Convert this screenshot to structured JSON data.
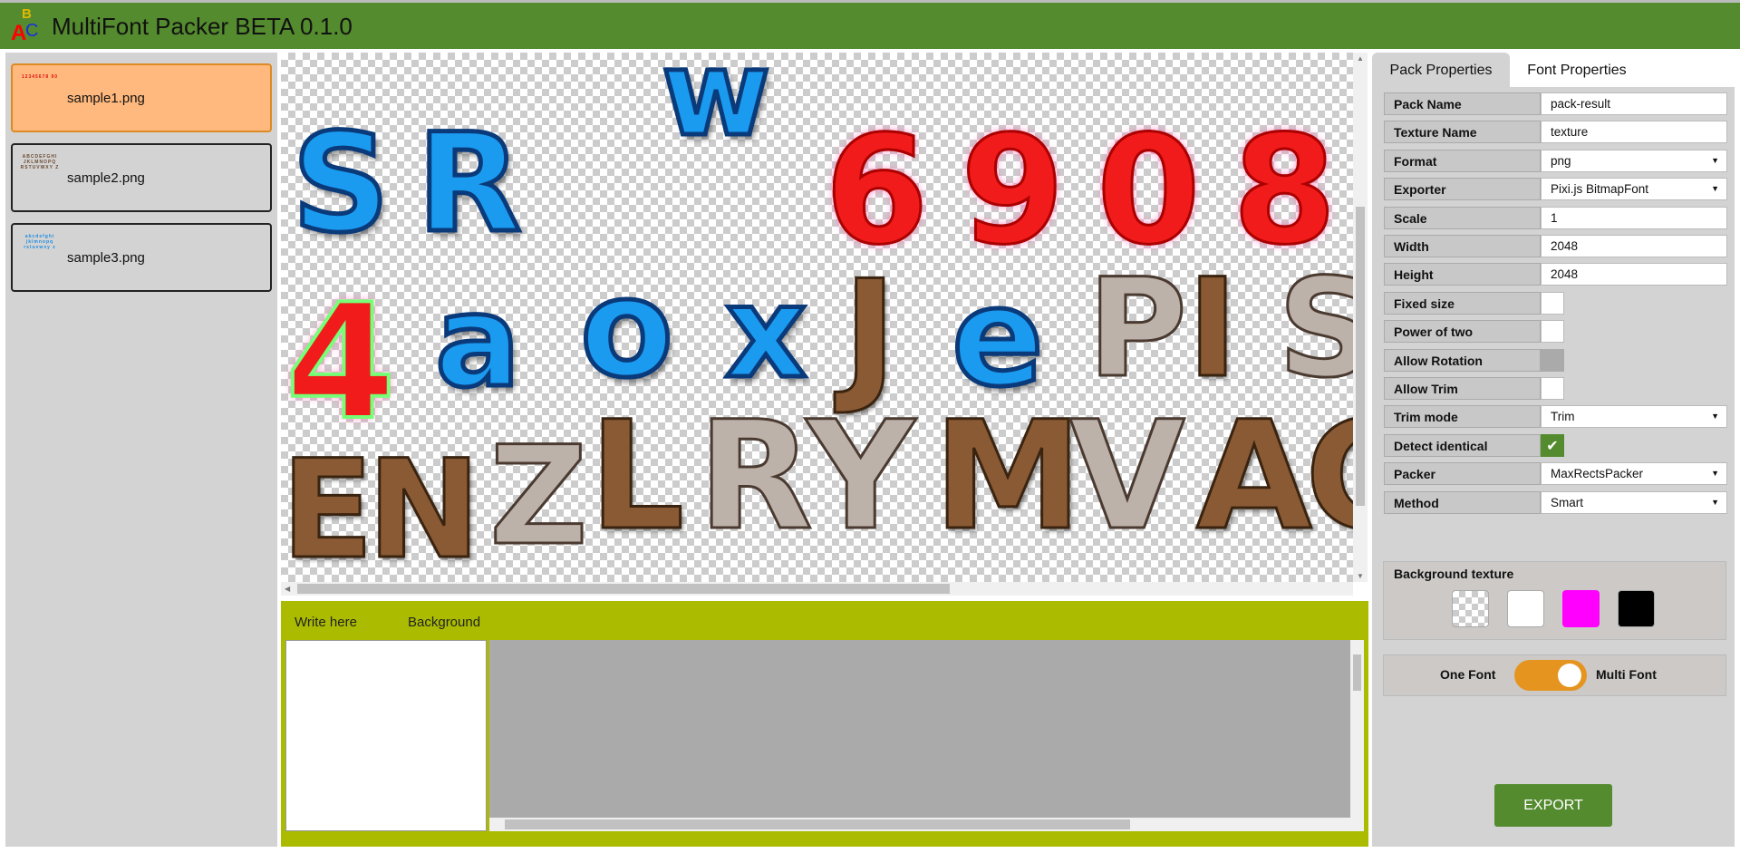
{
  "app": {
    "title": "MultiFont Packer BETA 0.1.0",
    "logo_letters": [
      "A",
      "B",
      "C"
    ]
  },
  "files": [
    {
      "name": "sample1.png",
      "thumb": "12345678 90",
      "selected": true,
      "thumb_color": "#e01010"
    },
    {
      "name": "sample2.png",
      "thumb": "ABCDEFGHI JKLMNOPQ RSTUVWXY Z",
      "selected": false,
      "thumb_color": "#6a4a30"
    },
    {
      "name": "sample3.png",
      "thumb": "abcdefghi jklmnopq rstuvwxy z",
      "selected": false,
      "thumb_color": "#1a8ae0"
    }
  ],
  "preview": {
    "glyphs": [
      "S",
      "R",
      "w",
      "6",
      "9",
      "0",
      "8",
      "4",
      "a",
      "o",
      "x",
      "J",
      "e",
      "P",
      "I",
      "S",
      "E",
      "N",
      "Z",
      "L",
      "R",
      "Y",
      "M",
      "V",
      "A",
      "C"
    ]
  },
  "bottom": {
    "write_label": "Write here",
    "background_label": "Background",
    "write_value": ""
  },
  "tabs": [
    "Pack Properties",
    "Font Properties"
  ],
  "props": [
    {
      "label": "Pack Name",
      "value": "pack-result",
      "type": "text"
    },
    {
      "label": "Texture Name",
      "value": "texture",
      "type": "text"
    },
    {
      "label": "Format",
      "value": "png",
      "type": "select"
    },
    {
      "label": "Exporter",
      "value": "Pixi.js BitmapFont",
      "type": "select"
    },
    {
      "label": "Scale",
      "value": "1",
      "type": "text"
    },
    {
      "label": "Width",
      "value": "2048",
      "type": "text"
    },
    {
      "label": "Height",
      "value": "2048",
      "type": "text"
    },
    {
      "label": "Fixed size",
      "checked": false,
      "type": "checkbox"
    },
    {
      "label": "Power of two",
      "checked": false,
      "type": "checkbox"
    },
    {
      "label": "Allow Rotation",
      "checked": false,
      "disabled": true,
      "type": "checkbox"
    },
    {
      "label": "Allow Trim",
      "checked": false,
      "type": "checkbox"
    },
    {
      "label": "Trim mode",
      "value": "Trim",
      "type": "select"
    },
    {
      "label": "Detect identical",
      "checked": true,
      "type": "checkbox"
    },
    {
      "label": "Packer",
      "value": "MaxRectsPacker",
      "type": "select"
    },
    {
      "label": "Method",
      "value": "Smart",
      "type": "select"
    }
  ],
  "background_texture": {
    "label": "Background texture",
    "swatches": [
      "transparent",
      "#ffffff",
      "#ff00ff",
      "#000000"
    ]
  },
  "mode": {
    "left_label": "One Font",
    "right_label": "Multi Font",
    "multi": true
  },
  "export_label": "EXPORT",
  "colors": {
    "header": "#548b2e",
    "accent": "#e69420",
    "bottom": "#abbc00"
  }
}
